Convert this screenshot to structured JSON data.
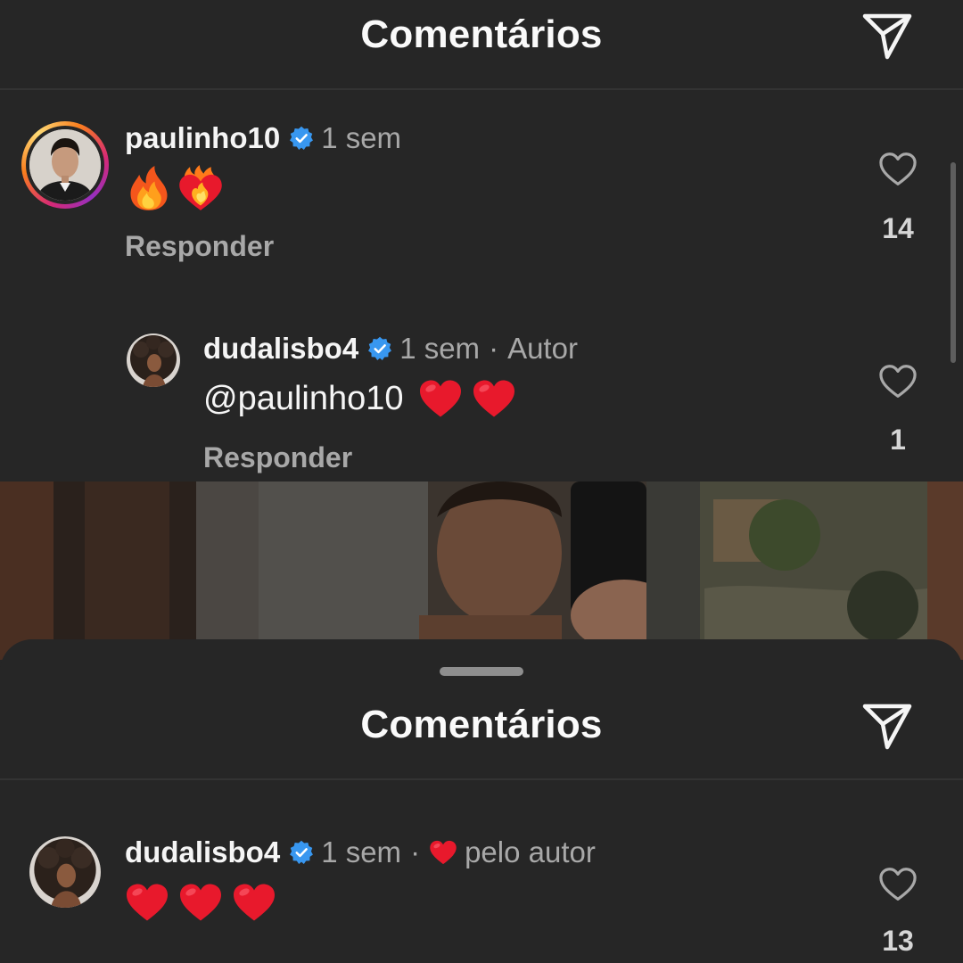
{
  "top_panel": {
    "title": "Comentários",
    "comments": [
      {
        "username": "paulinho10",
        "verified": true,
        "time": "1 sem",
        "emojis": [
          "fire",
          "heart-on-fire"
        ],
        "reply_label": "Responder",
        "likes": "14",
        "story_ring": true
      },
      {
        "username": "dudalisbo4",
        "verified": true,
        "time": "1 sem",
        "separator": "·",
        "author_tag": "Autor",
        "mention": "@paulinho10",
        "emojis": [
          "red-heart",
          "red-heart"
        ],
        "reply_label": "Responder",
        "likes": "1"
      }
    ]
  },
  "bottom_sheet": {
    "title": "Comentários",
    "comments": [
      {
        "username": "dudalisbo4",
        "verified": true,
        "time": "1 sem",
        "separator": "·",
        "liked_by_author": "pelo autor",
        "emojis": [
          "red-heart",
          "red-heart",
          "red-heart"
        ],
        "likes": "13"
      }
    ]
  },
  "colors": {
    "background": "#262626",
    "text": "#f5f5f5",
    "muted": "#a8a8a8",
    "verified_blue": "#3897f0",
    "heart_red": "#ff3040"
  },
  "icons": {
    "send": "paper-plane-icon",
    "like": "heart-outline-icon",
    "verified": "verified-badge-icon"
  }
}
